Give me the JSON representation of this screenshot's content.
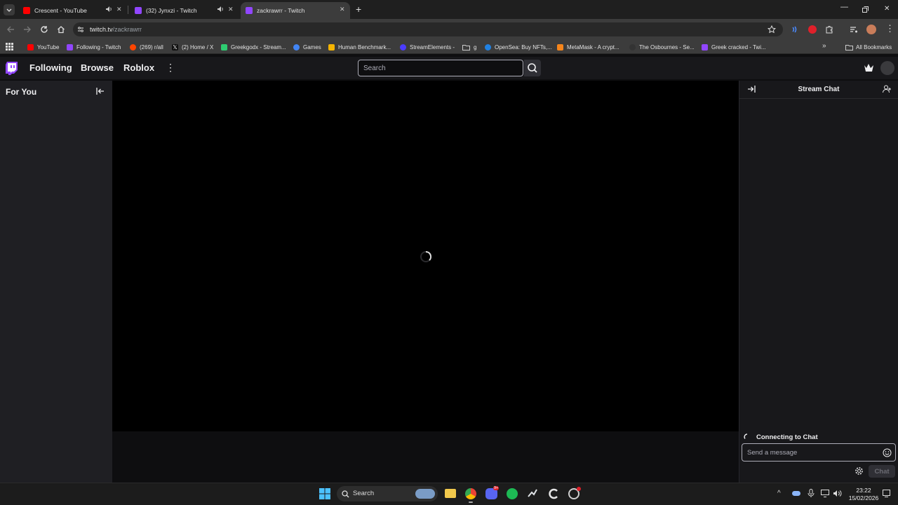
{
  "browser": {
    "tabs": [
      {
        "title": "Crescent - YouTube",
        "active": false,
        "audio": true,
        "favicon_color": "#ff0000"
      },
      {
        "title": "(32) Jynxzi - Twitch",
        "active": false,
        "audio": true,
        "favicon_color": "#9146ff"
      },
      {
        "title": "zackrawrr - Twitch",
        "active": true,
        "audio": false,
        "favicon_color": "#9146ff"
      }
    ],
    "new_tab_label": "+",
    "url_domain": "twitch.tv",
    "url_path": "/zackrawrr",
    "bookmarks": [
      {
        "label": "YouTube",
        "icon_color": "#ff0000"
      },
      {
        "label": "Following - Twitch",
        "icon_color": "#9146ff"
      },
      {
        "label": "(269) r/all",
        "icon_color": "#ff4500"
      },
      {
        "label": "(2) Home / X",
        "icon_color": "#000000"
      },
      {
        "label": "Greekgodx - Stream...",
        "icon_color": "#2ecc71"
      },
      {
        "label": "Games",
        "icon_color": "#4285f4"
      },
      {
        "label": "Human Benchmark...",
        "icon_color": "#f5b400"
      },
      {
        "label": "StreamElements -",
        "icon_color": "#4b3cff"
      },
      {
        "label": "g",
        "icon_color": "#9aa0a6"
      },
      {
        "label": "OpenSea: Buy NFTs,...",
        "icon_color": "#2081e2"
      },
      {
        "label": "MetaMask - A crypt...",
        "icon_color": "#f6851b"
      },
      {
        "label": "The Osbournes - Se...",
        "icon_color": "#333333"
      },
      {
        "label": "Greek cracked - Twi...",
        "icon_color": "#9146ff"
      }
    ],
    "all_bookmarks": "All Bookmarks"
  },
  "twitch": {
    "brand_color": "#9146ff",
    "nav": {
      "following": "Following",
      "browse": "Browse",
      "roblox": "Roblox"
    },
    "search_placeholder": "Search",
    "sidebar_title": "For You",
    "chat": {
      "title": "Stream Chat",
      "status": "Connecting to Chat",
      "input_placeholder": "Send a message",
      "send_label": "Chat"
    }
  },
  "taskbar": {
    "search_label": "Search",
    "time": "23:22",
    "date": "15/02/2026",
    "discord_badge": "9+"
  }
}
